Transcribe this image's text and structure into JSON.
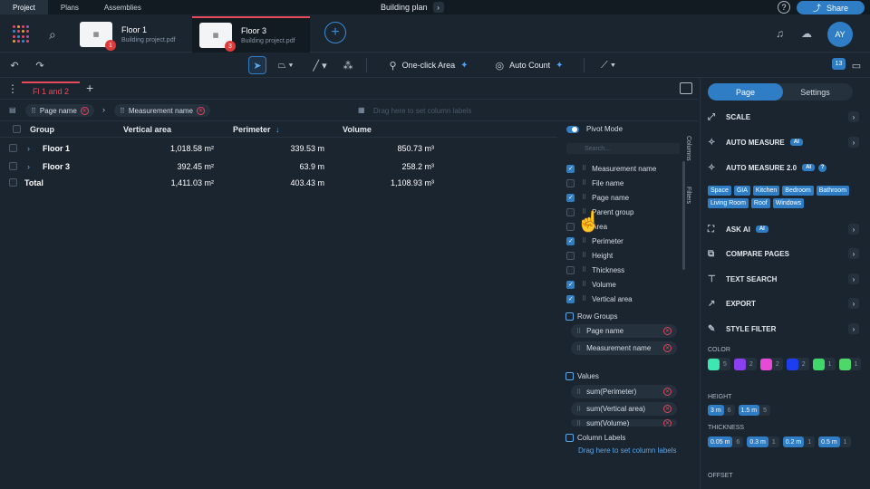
{
  "top": {
    "tabs": [
      "Project",
      "Plans",
      "Assemblies"
    ],
    "active_tab": 0,
    "title": "Building plan",
    "title_chevron": "›",
    "help": "?",
    "share": "Share"
  },
  "files": [
    {
      "title": "Floor 1",
      "sub": "Building project.pdf",
      "badge": "1",
      "active": false
    },
    {
      "title": "Floor 3",
      "sub": "Building project.pdf",
      "badge": "3",
      "active": true
    }
  ],
  "avatar": "AY",
  "toolbar": {
    "area_label": "One-click Area",
    "count_label": "Auto Count",
    "badge_count": "13"
  },
  "view": {
    "tab": "Fl 1 and 2",
    "drag_hint": "Drag here to set column labels",
    "group_chips": [
      "Page name",
      "Measurement name"
    ]
  },
  "table": {
    "headers": [
      "Group",
      "Vertical area",
      "Perimeter",
      "Volume"
    ],
    "sort_arrow": "↓",
    "rows": [
      {
        "name": "Floor 1",
        "vertical_area": "1,018.58 m²",
        "perimeter": "339.53 m",
        "volume": "850.73 m³",
        "expand": true
      },
      {
        "name": "Floor 3",
        "vertical_area": "392.45 m²",
        "perimeter": "63.9 m",
        "volume": "258.2 m³",
        "expand": true
      },
      {
        "name": "Total",
        "vertical_area": "1,411.03 m²",
        "perimeter": "403.43 m",
        "volume": "1,108.93 m³",
        "expand": false
      }
    ]
  },
  "pivot": {
    "mode_label": "Pivot Mode",
    "search_placeholder": "Search...",
    "columns": [
      {
        "label": "Measurement name",
        "checked": true
      },
      {
        "label": "File name",
        "checked": false
      },
      {
        "label": "Page name",
        "checked": true
      },
      {
        "label": "Parent group",
        "checked": false
      },
      {
        "label": "Area",
        "checked": false
      },
      {
        "label": "Perimeter",
        "checked": true
      },
      {
        "label": "Height",
        "checked": false
      },
      {
        "label": "Thickness",
        "checked": false
      },
      {
        "label": "Volume",
        "checked": true
      },
      {
        "label": "Vertical area",
        "checked": true
      }
    ],
    "row_groups_title": "Row Groups",
    "row_groups": [
      "Page name",
      "Measurement name"
    ],
    "values_title": "Values",
    "values": [
      "sum(Perimeter)",
      "sum(Vertical area)",
      "sum(Volume)"
    ],
    "col_labels_title": "Column Labels",
    "col_labels_hint": "Drag here to set column labels",
    "side_tabs": [
      "Columns",
      "Filters"
    ]
  },
  "right": {
    "tabs": [
      "Page",
      "Settings"
    ],
    "items": [
      {
        "label": "SCALE",
        "ai": false
      },
      {
        "label": "AUTO MEASURE",
        "ai": true
      },
      {
        "label": "AUTO MEASURE 2.0",
        "ai": true
      },
      {
        "label": "ASK AI",
        "ai": true
      },
      {
        "label": "COMPARE PAGES",
        "ai": false
      },
      {
        "label": "TEXT SEARCH",
        "ai": false
      },
      {
        "label": "EXPORT",
        "ai": false
      },
      {
        "label": "STYLE FILTER",
        "ai": false
      }
    ],
    "ai_badge": "AI",
    "tags": [
      "Space",
      "GIA",
      "Kitchen",
      "Bedroom",
      "Bathroom",
      "Living Room",
      "Roof",
      "Windows"
    ],
    "color_label": "COLOR",
    "colors": [
      {
        "hex": "#3ee6b0",
        "n": "5"
      },
      {
        "hex": "#8a3ff0",
        "n": "2"
      },
      {
        "hex": "#e64bd8",
        "n": "2"
      },
      {
        "hex": "#1d3df0",
        "n": "2"
      },
      {
        "hex": "#3ed86a",
        "n": "1"
      },
      {
        "hex": "#4fd86a",
        "n": "1"
      }
    ],
    "height_label": "HEIGHT",
    "heights": [
      {
        "v": "3 m",
        "n": "6"
      },
      {
        "v": "1.5 m",
        "n": "5"
      }
    ],
    "thickness_label": "THICKNESS",
    "thicknesses": [
      {
        "v": "0.05 m",
        "n": "6"
      },
      {
        "v": "0.3 m",
        "n": "1"
      },
      {
        "v": "0.2 m",
        "n": "1"
      },
      {
        "v": "0.5 m",
        "n": "1"
      }
    ],
    "offset_label": "OFFSET"
  }
}
